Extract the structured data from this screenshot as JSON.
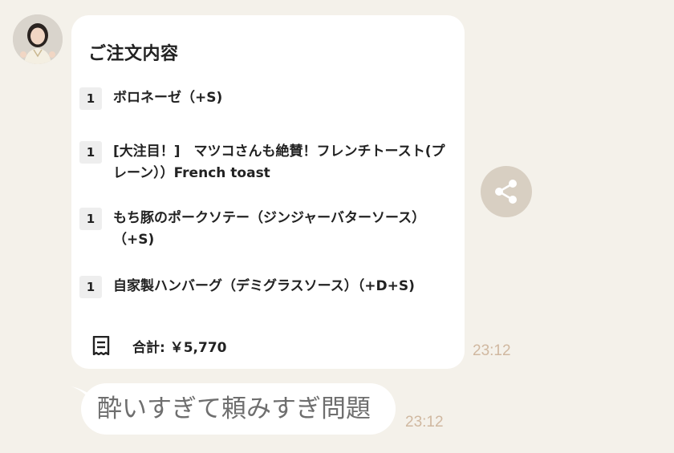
{
  "chat": {
    "order_message": {
      "title": "ご注文内容",
      "items": [
        {
          "qty": "1",
          "name": "ボロネーゼ（+S)"
        },
        {
          "qty": "1",
          "name": "[大注目！]　マツコさんも絶賛！フレンチトースト(プレーン））French toast"
        },
        {
          "qty": "1",
          "name": "もち豚のポークソテー（ジンジャーバターソース）（+S)"
        },
        {
          "qty": "1",
          "name": "自家製ハンバーグ（デミグラスソース）（+D+S)"
        }
      ],
      "total": "合計: ￥5,770",
      "timestamp": "23:12"
    },
    "text_message": {
      "text": "酔いすぎて頼みすぎ問題",
      "timestamp": "23:12"
    }
  },
  "icons": {
    "share": "share-icon",
    "receipt": "receipt-icon",
    "avatar": "avatar"
  },
  "colors": {
    "background": "#f4f1ea",
    "bubble": "#ffffff",
    "share_button": "#d8cfc2",
    "timestamp": "#d0b8a0",
    "message_text": "#6e6e6e"
  }
}
